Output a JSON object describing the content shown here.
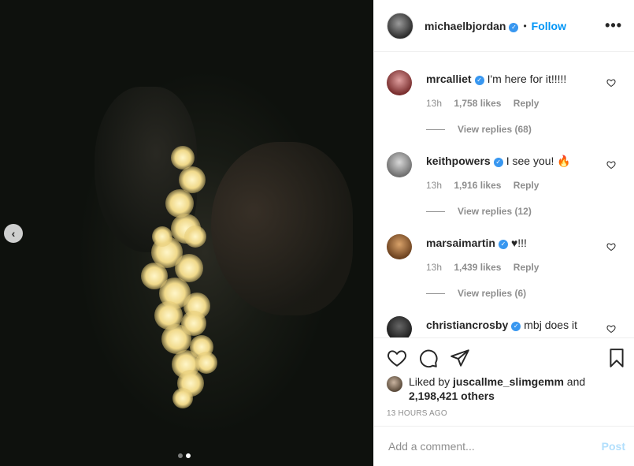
{
  "header": {
    "username": "michaelbjordan",
    "separator": "•",
    "follow_label": "Follow",
    "more_label": "•••"
  },
  "post": {
    "carousel_prev_icon": "‹",
    "carousel_dots_count": 2,
    "carousel_active_index": 1
  },
  "comments": [
    {
      "user": "mrcalliet",
      "text": "I'm here for it!!!!!",
      "time": "13h",
      "likes": "1,758 likes",
      "reply": "Reply",
      "view_replies": "View replies (68)",
      "avatar_color": "#7a2f2f"
    },
    {
      "user": "keithpowers",
      "text": "I see you! 🔥",
      "time": "13h",
      "likes": "1,916 likes",
      "reply": "Reply",
      "view_replies": "View replies (12)",
      "avatar_color": "#9a9a9a"
    },
    {
      "user": "marsaimartin",
      "text": "♥!!!",
      "time": "13h",
      "likes": "1,439 likes",
      "reply": "Reply",
      "view_replies": "View replies (6)",
      "avatar_color": "#8a5a32"
    },
    {
      "user": "christiancrosby",
      "text": "mbj does it",
      "avatar_color": "#2a2a2a"
    }
  ],
  "likes": {
    "liked_by_prefix": "Liked by",
    "liked_by_user": "juscallme_slimgemm",
    "and": "and",
    "others": "2,198,421 others"
  },
  "time_ago": "13 HOURS AGO",
  "add_comment": {
    "placeholder": "Add a comment...",
    "post_label": "Post"
  },
  "colors": {
    "accent": "#0095f6",
    "verified": "#3897f0",
    "post_disabled": "#b2dffc",
    "muted": "#8e8e8e"
  }
}
